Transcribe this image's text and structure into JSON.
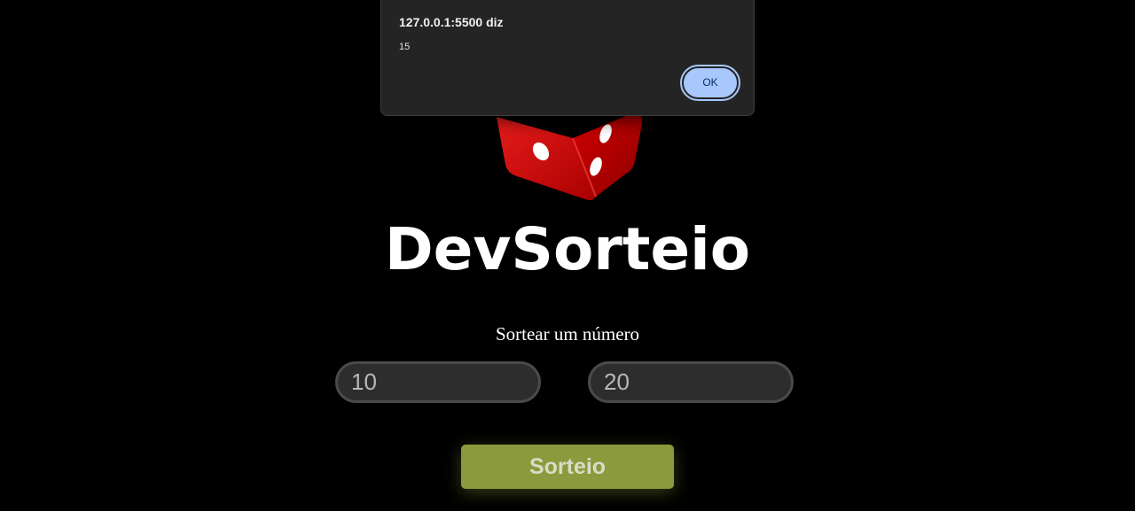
{
  "alert": {
    "origin": "127.0.0.1:5500 diz",
    "message": "15",
    "ok_label": "OK",
    "button_color": "#a8c7fa"
  },
  "header": {
    "logo_icon": "red-dice-icon",
    "title": "DevSorteio"
  },
  "form": {
    "subtitle": "Sortear um número",
    "min_value": "10",
    "max_value": "20",
    "submit_label": "Sorteio"
  },
  "colors": {
    "background": "#000000",
    "dice": "#d40000",
    "button": "#8b9a3c",
    "input_bg": "#2d2d2d"
  }
}
